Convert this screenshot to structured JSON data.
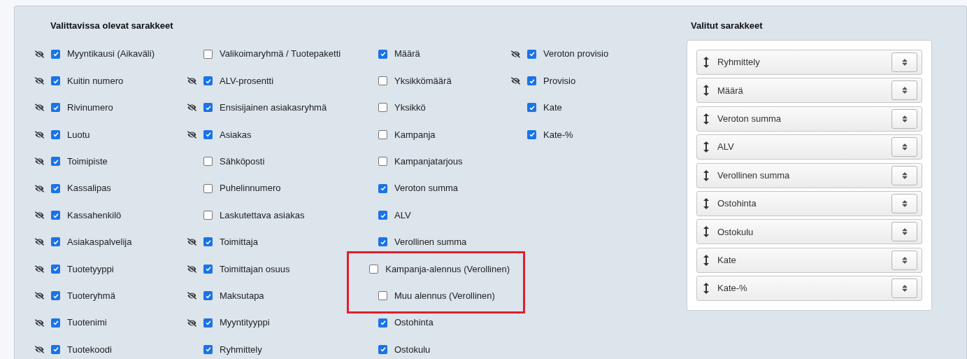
{
  "available": {
    "title": "Valittavissa olevat sarakkeet",
    "columns": [
      {
        "items": [
          {
            "label": "Myyntikausi (Aikaväli)",
            "checked": true,
            "eye_icon": true
          },
          {
            "label": "Kuitin numero",
            "checked": true,
            "eye_icon": true
          },
          {
            "label": "Rivinumero",
            "checked": true,
            "eye_icon": true
          },
          {
            "label": "Luotu",
            "checked": true,
            "eye_icon": true
          },
          {
            "label": "Toimipiste",
            "checked": true,
            "eye_icon": true
          },
          {
            "label": "Kassalipas",
            "checked": true,
            "eye_icon": true
          },
          {
            "label": "Kassahenkilö",
            "checked": true,
            "eye_icon": true
          },
          {
            "label": "Asiakaspalvelija",
            "checked": true,
            "eye_icon": true
          },
          {
            "label": "Tuotetyyppi",
            "checked": true,
            "eye_icon": true
          },
          {
            "label": "Tuoteryhmä",
            "checked": true,
            "eye_icon": true
          },
          {
            "label": "Tuotenimi",
            "checked": true,
            "eye_icon": true
          },
          {
            "label": "Tuotekoodi",
            "checked": true,
            "eye_icon": true
          }
        ]
      },
      {
        "items": [
          {
            "label": "Valikoimaryhmä / Tuotepaketti",
            "checked": false,
            "eye_icon": false
          },
          {
            "label": "ALV-prosentti",
            "checked": true,
            "eye_icon": true
          },
          {
            "label": "Ensisijainen asiakasryhmä",
            "checked": true,
            "eye_icon": true
          },
          {
            "label": "Asiakas",
            "checked": true,
            "eye_icon": true
          },
          {
            "label": "Sähköposti",
            "checked": false,
            "eye_icon": false
          },
          {
            "label": "Puhelinnumero",
            "checked": false,
            "eye_icon": false
          },
          {
            "label": "Laskutettava asiakas",
            "checked": false,
            "eye_icon": false
          },
          {
            "label": "Toimittaja",
            "checked": true,
            "eye_icon": true
          },
          {
            "label": "Toimittajan osuus",
            "checked": true,
            "eye_icon": true
          },
          {
            "label": "Maksutapa",
            "checked": true,
            "eye_icon": true
          },
          {
            "label": "Myyntityyppi",
            "checked": true,
            "eye_icon": true
          },
          {
            "label": "Ryhmittely",
            "checked": true,
            "eye_icon": false
          }
        ]
      },
      {
        "items": [
          {
            "label": "Määrä",
            "checked": true,
            "eye_icon": false,
            "highlighted": false
          },
          {
            "label": "Yksikkömäärä",
            "checked": false,
            "eye_icon": false,
            "highlighted": false
          },
          {
            "label": "Yksikkö",
            "checked": false,
            "eye_icon": false,
            "highlighted": false
          },
          {
            "label": "Kampanja",
            "checked": false,
            "eye_icon": false,
            "highlighted": false
          },
          {
            "label": "Kampanjatarjous",
            "checked": false,
            "eye_icon": false,
            "highlighted": false
          },
          {
            "label": "Veroton summa",
            "checked": true,
            "eye_icon": false,
            "highlighted": false
          },
          {
            "label": "ALV",
            "checked": true,
            "eye_icon": false,
            "highlighted": false
          },
          {
            "label": "Verollinen summa",
            "checked": true,
            "eye_icon": false,
            "highlighted": false
          },
          {
            "label": "Kampanja-alennus (Verollinen)",
            "checked": false,
            "eye_icon": false,
            "highlighted": true
          },
          {
            "label": "Muu alennus (Verollinen)",
            "checked": false,
            "eye_icon": false,
            "highlighted": true
          },
          {
            "label": "Ostohinta",
            "checked": true,
            "eye_icon": false,
            "highlighted": false
          },
          {
            "label": "Ostokulu",
            "checked": true,
            "eye_icon": false,
            "highlighted": false
          }
        ]
      },
      {
        "items": [
          {
            "label": "Veroton provisio",
            "checked": true,
            "eye_icon": true
          },
          {
            "label": "Provisio",
            "checked": true,
            "eye_icon": true
          },
          {
            "label": "Kate",
            "checked": true,
            "eye_icon": false
          },
          {
            "label": "Kate-%",
            "checked": true,
            "eye_icon": false
          }
        ]
      }
    ]
  },
  "selected": {
    "title": "Valitut sarakkeet",
    "items": [
      "Ryhmittely",
      "Määrä",
      "Veroton summa",
      "ALV",
      "Verollinen summa",
      "Ostohinta",
      "Ostokulu",
      "Kate",
      "Kate-%"
    ]
  }
}
